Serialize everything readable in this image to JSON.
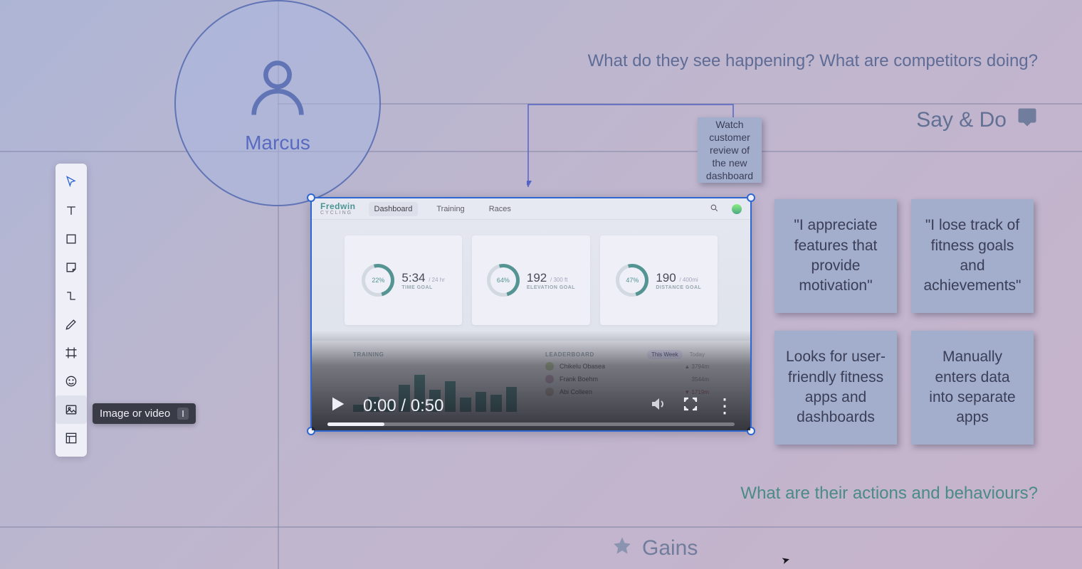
{
  "persona": {
    "name": "Marcus"
  },
  "prompts": {
    "see": "What do they see happening? What are competitors doing?",
    "saydo": "Say & Do",
    "actions": "What are their actions and behaviours?",
    "gains": "Gains"
  },
  "stickies": {
    "watch": "Watch customer review of the new dashboard",
    "s1": "\"I appreciate features that provide motivation\"",
    "s2": "\"I lose track of fitness goals and achievements\"",
    "s3": "Looks for user-friendly fitness apps and dashboards",
    "s4": "Manually enters data into separate apps"
  },
  "toolbar": {
    "items": [
      {
        "name": "select",
        "icon": "cursor"
      },
      {
        "name": "text",
        "icon": "text"
      },
      {
        "name": "rectangle",
        "icon": "square"
      },
      {
        "name": "sticky",
        "icon": "note"
      },
      {
        "name": "connector",
        "icon": "connector"
      },
      {
        "name": "pen",
        "icon": "pen"
      },
      {
        "name": "frame",
        "icon": "frame"
      },
      {
        "name": "stamp",
        "icon": "palette"
      },
      {
        "name": "image",
        "icon": "image"
      },
      {
        "name": "template",
        "icon": "layout"
      }
    ],
    "tooltip": {
      "label": "Image or video",
      "key": "I"
    }
  },
  "video": {
    "app": {
      "brand": "Fredwin",
      "brand_sub": "CYCLING",
      "tabs": [
        "Dashboard",
        "Training",
        "Races"
      ],
      "active_tab": "Dashboard"
    },
    "cards": [
      {
        "pct": "22%",
        "big": "5:34",
        "unit": "/ 24 hr",
        "label": "TIME GOAL"
      },
      {
        "pct": "64%",
        "big": "192",
        "unit": "/ 300 ft",
        "label": "ELEVATION GOAL"
      },
      {
        "pct": "47%",
        "big": "190",
        "unit": "/ 400mi",
        "label": "DISTANCE GOAL"
      }
    ],
    "training_label": "TRAINING",
    "leaderboard": {
      "label": "LEADERBOARD",
      "tabs": [
        "This Week",
        "Today"
      ],
      "rows": [
        {
          "name": "Chikelu Obasea",
          "val": "3794m"
        },
        {
          "name": "Frank Boehm",
          "val": "3544m"
        },
        {
          "name": "Abi Colleen",
          "val": "1719m"
        }
      ]
    },
    "controls": {
      "time": "0:00 / 0:50"
    }
  }
}
